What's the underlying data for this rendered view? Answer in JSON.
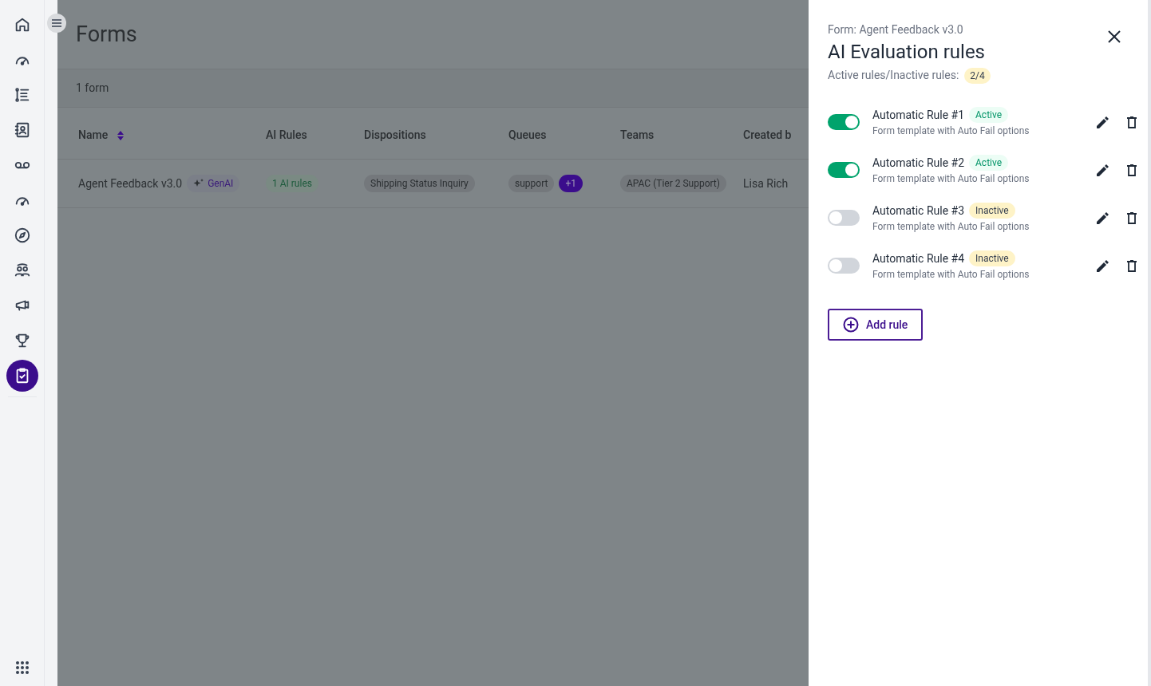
{
  "sidebar": {
    "items": [
      {
        "selected": false
      },
      {
        "selected": false
      },
      {
        "selected": false
      },
      {
        "selected": false
      },
      {
        "selected": false
      },
      {
        "selected": false
      },
      {
        "selected": false
      },
      {
        "selected": false
      },
      {
        "selected": false
      },
      {
        "selected": false
      },
      {
        "selected": true
      }
    ]
  },
  "page": {
    "title": "Forms",
    "count": "1 form"
  },
  "table": {
    "columns": [
      "Name",
      "AI Rules",
      "Dispositions",
      "Queues",
      "Teams",
      "Created b"
    ],
    "rows": [
      {
        "name": "Agent Feedback v3.0",
        "genai": "GenAI",
        "ai_rules": "1 AI rules",
        "dispositions": [
          "Shipping Status Inquiry"
        ],
        "queues": [
          "support"
        ],
        "queues_more": "+1",
        "teams": [
          "APAC (Tier 2 Support)"
        ],
        "created_by": "Lisa Rich"
      }
    ]
  },
  "drawer": {
    "subtitle": "Form: Agent Feedback v3.0",
    "title": "AI Evaluation rules",
    "summary_label": "Active rules/Inactive rules:",
    "summary_value": "2/4",
    "rules": [
      {
        "name": "Automatic Rule #1",
        "status": "Active",
        "on": true,
        "description": "Form template with Auto Fail options"
      },
      {
        "name": "Automatic Rule #2",
        "status": "Active",
        "on": true,
        "description": "Form template with Auto Fail options"
      },
      {
        "name": "Automatic Rule #3",
        "status": "Inactive",
        "on": false,
        "description": "Form template with Auto Fail options"
      },
      {
        "name": "Automatic Rule #4",
        "status": "Inactive",
        "on": false,
        "description": "Form template with Auto Fail options"
      }
    ],
    "add_button": "Add rule"
  }
}
